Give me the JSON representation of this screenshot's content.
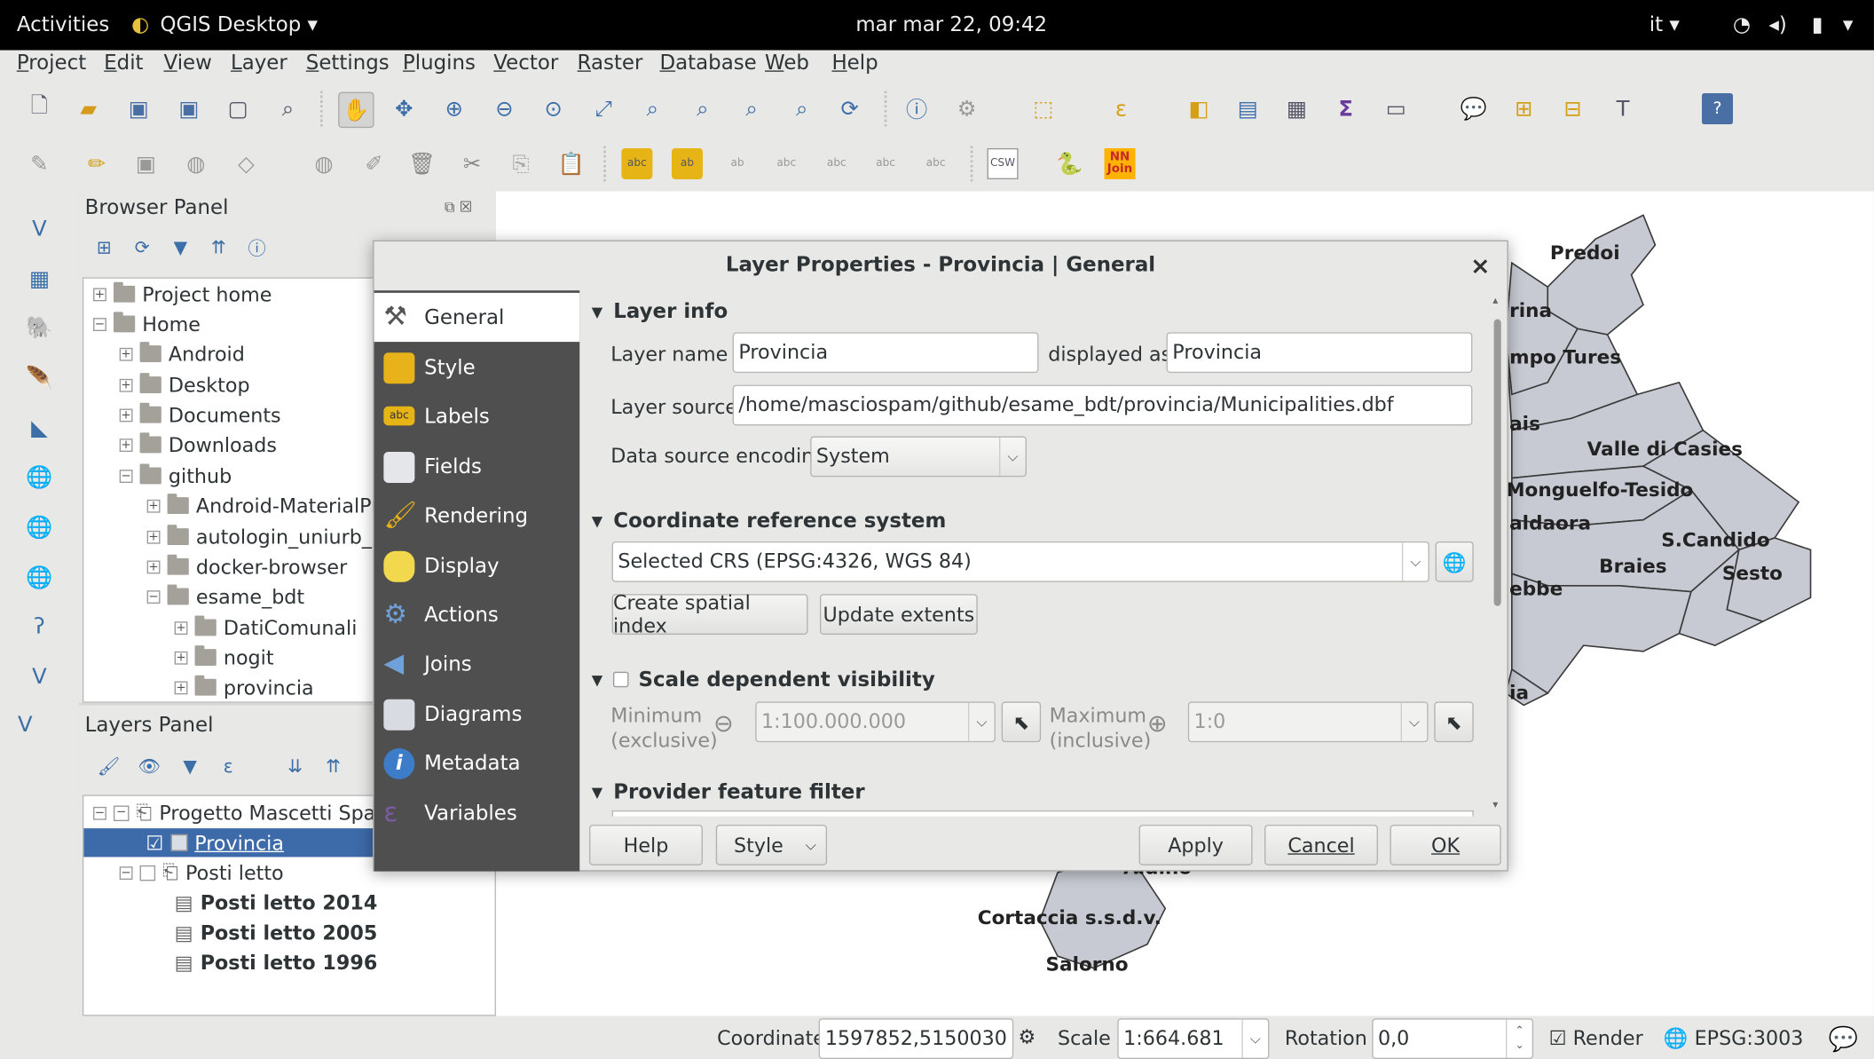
{
  "topbar": {
    "activities": "Activities",
    "app": "QGIS Desktop ▾",
    "clock": "mar mar 22, 09:42",
    "lang": "it ▾"
  },
  "menu": [
    "Project",
    "Edit",
    "View",
    "Layer",
    "Settings",
    "Plugins",
    "Vector",
    "Raster",
    "Database",
    "Web",
    "Help"
  ],
  "browser": {
    "title": "Browser Panel",
    "items": [
      "Project home",
      "Home",
      "Android",
      "Desktop",
      "Documents",
      "Downloads",
      "github",
      "Android-MaterialPre",
      "autologin_uniurb_n",
      "docker-browser",
      "esame_bdt",
      "DatiComunali",
      "nogit",
      "provincia"
    ]
  },
  "layers": {
    "title": "Layers Panel",
    "items": [
      "Progetto Mascetti Spa",
      "Provincia",
      "Posti letto",
      "Posti letto 2014",
      "Posti letto 2005",
      "Posti letto 1996"
    ]
  },
  "map_labels": [
    "Predoi",
    "rina",
    "mpo Tures",
    "ais",
    "Valle di Casies",
    "Monguelfo-Tesido",
    "aldaora",
    "S.Candido",
    "Braies",
    "Sesto",
    "ebbe",
    "ia",
    "Cortaccia s.s.d.v.",
    "Salorno",
    "Aldino"
  ],
  "dialog": {
    "title": "Layer Properties - Provincia | General",
    "close": "×",
    "nav": [
      "General",
      "Style",
      "Labels",
      "Fields",
      "Rendering",
      "Display",
      "Actions",
      "Joins",
      "Diagrams",
      "Metadata",
      "Variables"
    ],
    "layer_info": {
      "header": "Layer info",
      "name_label": "Layer name",
      "name_value": "Provincia",
      "displayed_label": "displayed as",
      "displayed_value": "Provincia",
      "source_label": "Layer source",
      "source_value": "/home/masciospam/github/esame_bdt/provincia/Municipalities.dbf",
      "encoding_label": "Data source encoding",
      "encoding_value": "System"
    },
    "crs": {
      "header": "Coordinate reference system",
      "value": "Selected CRS (EPSG:4326, WGS 84)",
      "btn_index": "Create spatial index",
      "btn_extents": "Update extents"
    },
    "scale": {
      "header": "Scale dependent visibility",
      "min_label1": "Minimum",
      "min_label2": "(exclusive)",
      "min_value": "1:100.000.000",
      "max_label1": "Maximum",
      "max_label2": "(inclusive)",
      "max_value": "1:0"
    },
    "filter": {
      "header": "Provider feature filter"
    },
    "buttons": {
      "help": "Help",
      "style": "Style",
      "apply": "Apply",
      "cancel": "Cancel",
      "ok": "OK"
    }
  },
  "status": {
    "coord_label": "Coordinate",
    "coord_value": "1597852,5150030",
    "scale_label": "Scale",
    "scale_value": "1:664.681",
    "rotation_label": "Rotation",
    "rotation_value": "0,0",
    "render_label": "Render",
    "crs": "EPSG:3003"
  }
}
